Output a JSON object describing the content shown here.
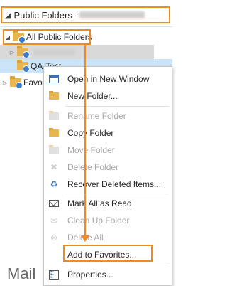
{
  "header": {
    "title": "Public Folders - ",
    "chevron": "◢"
  },
  "tree": {
    "all_public_folders": "All Public Folders",
    "qa_test": "QA-Test",
    "favorites": "Favor"
  },
  "context_menu": {
    "items": [
      {
        "label": "Open in New Window",
        "icon": "open-window-icon"
      },
      {
        "label": "New Folder...",
        "icon": "new-folder-icon"
      },
      {
        "label": "Rename Folder",
        "icon": "rename-folder-icon"
      },
      {
        "label": "Copy Folder",
        "icon": "copy-folder-icon"
      },
      {
        "label": "Move Folder",
        "icon": "move-folder-icon"
      },
      {
        "label": "Delete Folder",
        "icon": "delete-folder-icon"
      },
      {
        "label": "Recover Deleted Items...",
        "icon": "recover-items-icon"
      },
      {
        "label": "Mark All as Read",
        "icon": "mark-read-icon"
      },
      {
        "label": "Clean Up Folder",
        "icon": "clean-up-icon"
      },
      {
        "label": "Delete All",
        "icon": "delete-all-icon"
      },
      {
        "label": "Add to Favorites...",
        "icon": ""
      },
      {
        "label": "Properties...",
        "icon": "properties-icon"
      }
    ]
  },
  "bottom": {
    "mail_label": "Mail"
  },
  "colors": {
    "highlight": "#f08c1e",
    "folder": "#e8b650",
    "globe": "#3d7cc9"
  }
}
